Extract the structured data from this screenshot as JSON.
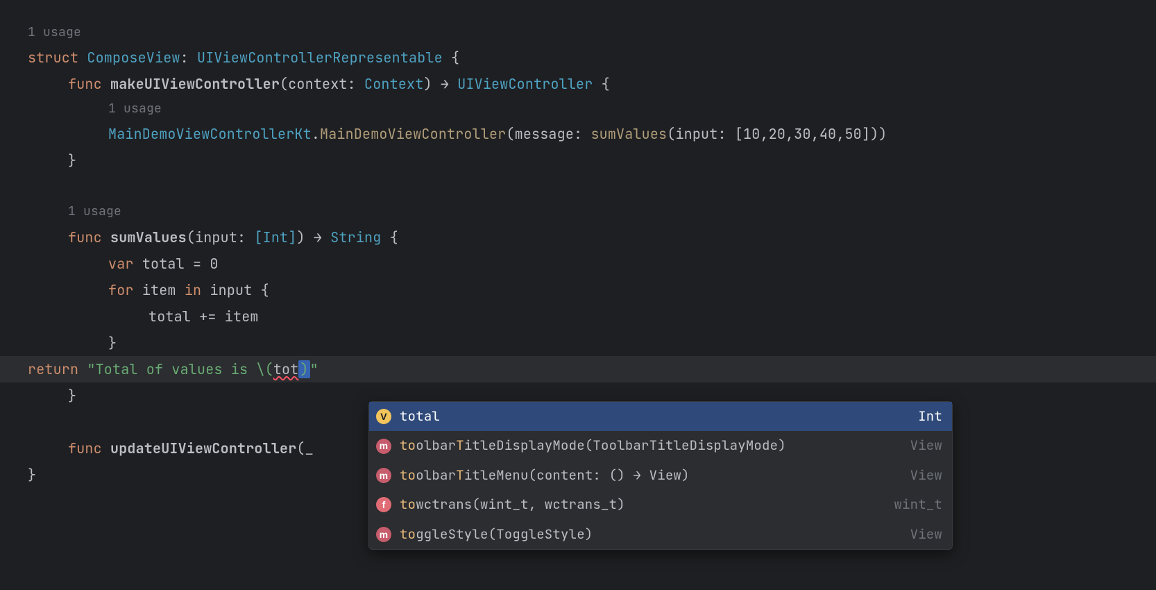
{
  "hints": {
    "usage1": "1 usage",
    "usage2": "1 usage",
    "usage3": "1 usage"
  },
  "code": {
    "struct_kw": "struct",
    "struct_name": "ComposeView",
    "proto": "UIViewControllerRepresentable",
    "func_kw": "func",
    "make_name": "makeUIViewController",
    "make_param": "context",
    "make_paramtype": "Context",
    "arrow": "→",
    "make_ret": "UIViewController",
    "call_prefix": "MainDemoViewControllerKt",
    "call_method": "MainDemoViewController",
    "call_arg1": "message",
    "call_sum": "sumValues",
    "call_arg2": "input",
    "array": "[10,20,30,40,50]",
    "sum_name": "sumValues",
    "sum_param": "input",
    "sum_paramtype": "[Int]",
    "sum_ret": "String",
    "var_kw": "var",
    "total": "total",
    "zero": "= 0",
    "for_kw": "for",
    "item": "item",
    "in_kw": "in",
    "input": "input",
    "accum": "total += item",
    "return_kw": "return",
    "str_open": "\"Total of values is \\(",
    "tot": "tot",
    "str_close": ")\"",
    "update_name": "updateUIViewController",
    "update_tail": "(_"
  },
  "popup": {
    "items": [
      {
        "icon": "v",
        "prefix": "tot",
        "rest": "al",
        "type": "Int",
        "selected": true
      },
      {
        "icon": "m",
        "prefix": "to",
        "rest": "olbarTitleDisplayMode(ToolbarTitleDisplayMode)",
        "type": "View",
        "selected": false,
        "hlchars": [
          7
        ]
      },
      {
        "icon": "m",
        "prefix": "to",
        "rest": "olbarTitleMenu(content: () → View)",
        "type": "View",
        "selected": false,
        "hlchars": [
          7
        ]
      },
      {
        "icon": "f",
        "prefix": "to",
        "rest": "wctrans(wint_t, wctrans_t)",
        "type": "wint_t",
        "selected": false
      },
      {
        "icon": "m",
        "prefix": "to",
        "rest": "ggleStyle(ToggleStyle)",
        "type": "View",
        "selected": false
      }
    ]
  }
}
